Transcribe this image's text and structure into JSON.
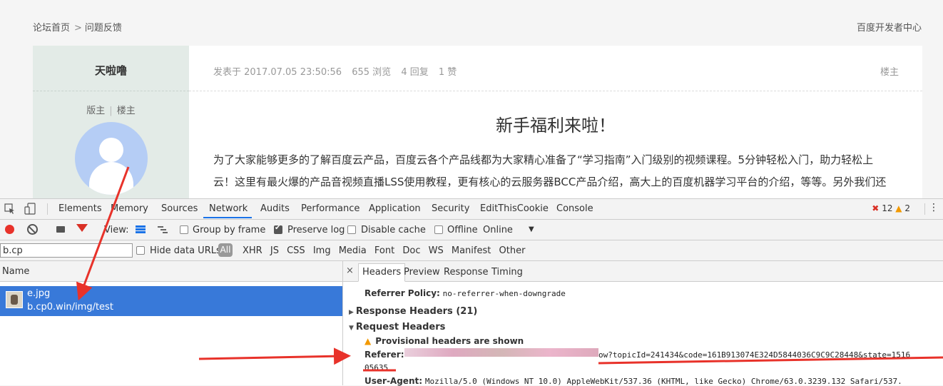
{
  "forum": {
    "breadcrumb_home": "论坛首页",
    "breadcrumb_sep": ">",
    "breadcrumb_current": "问题反馈",
    "dev_center_link": "百度开发者中心",
    "author": {
      "name": "天啦噜",
      "role_1": "版主",
      "role_2": "楼主"
    },
    "post": {
      "posted_at": "发表于 2017.07.05 23:50:56",
      "views": "655 浏览",
      "replies": "4 回复",
      "likes": "1 赞",
      "owner_tag": "楼主",
      "title": "新手福利来啦！",
      "line_1": "为了大家能够更多的了解百度云产品，百度云各个产品线都为大家精心准备了“学习指南”入门级别的视频课程。5分钟轻松入门，助力轻松上",
      "line_2": "云！这里有最火爆的产品音视频直播LSS使用教程，更有核心的云服务器BCC产品介绍，高大上的百度机器学习平台的介绍，等等。另外我们还"
    }
  },
  "devtools": {
    "tabs": [
      "Elements",
      "Memory",
      "Sources",
      "Network",
      "Audits",
      "Performance",
      "Application",
      "Security",
      "EditThisCookie",
      "Console"
    ],
    "active_tab": "Network",
    "error_count": "12",
    "warning_count": "2",
    "toolbar": {
      "view_label": "View:",
      "group_by_frame": "Group by frame",
      "preserve_log": "Preserve log",
      "disable_cache": "Disable cache",
      "offline": "Offline",
      "throttle": "Online",
      "throttle_arrow": "▼"
    },
    "filter": {
      "value": "b.cp",
      "hide_data_urls": "Hide data URLs",
      "all": "All",
      "types": [
        "XHR",
        "JS",
        "CSS",
        "Img",
        "Media",
        "Font",
        "Doc",
        "WS",
        "Manifest",
        "Other"
      ]
    },
    "request_list": {
      "header": "Name",
      "request_name": "e.jpg",
      "request_url": "b.cp0.win/img/test"
    },
    "details": {
      "close": "×",
      "tabs": [
        "Headers",
        "Preview",
        "Response",
        "Timing"
      ],
      "active_tab": "Headers",
      "referrer_policy_key": "Referrer Policy:",
      "referrer_policy_value": "no-referrer-when-downgrade",
      "response_headers": "Response Headers (21)",
      "request_headers": "Request Headers",
      "provisional": "Provisional headers are shown",
      "referer_key": "Referer:",
      "referer_value_visible": "ow?topicId=241434&code=161B913074E324D5844036C9C9C28448&state=1516",
      "referer_value_line2": "05635",
      "user_agent_key": "User-Agent:",
      "user_agent_value": "Mozilla/5.0 (Windows NT 10.0) AppleWebKit/537.36 (KHTML, like Gecko) Chrome/63.0.3239.132 Safari/537."
    }
  },
  "colors": {
    "accent_blue": "#1a73e8",
    "selected_row": "#3879d9",
    "annotation_red": "#e8322a",
    "author_panel": "#e3ebe7"
  }
}
